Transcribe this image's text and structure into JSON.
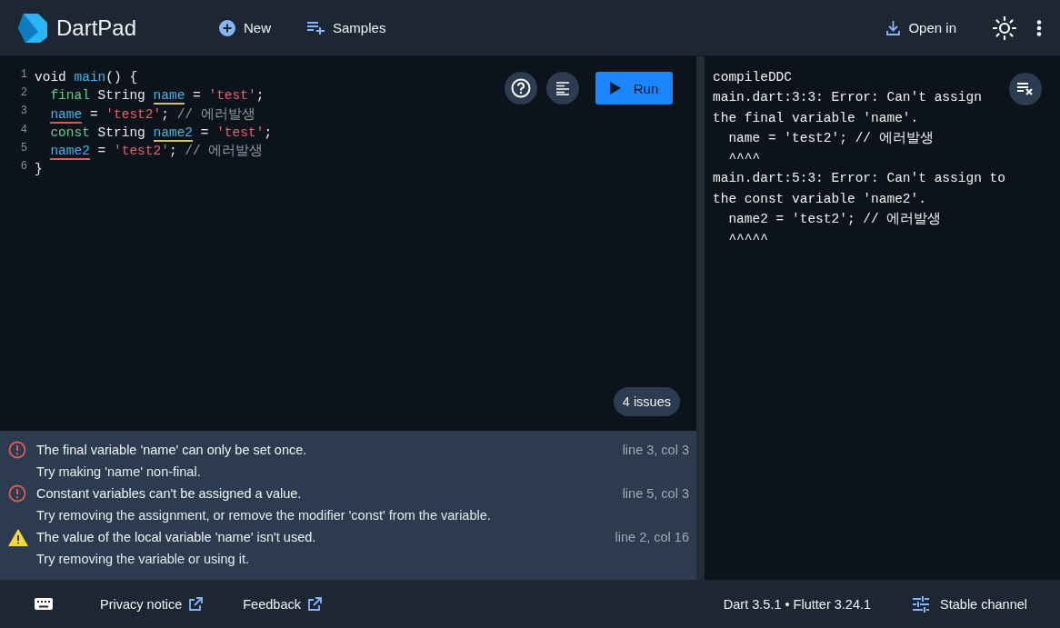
{
  "header": {
    "title": "DartPad",
    "actions": [
      {
        "kind": "new",
        "label": "New"
      },
      {
        "kind": "samples",
        "label": "Samples"
      }
    ],
    "open_in": "Open in"
  },
  "editor": {
    "lines": [
      {
        "number": "1",
        "indented": false,
        "tokens": [
          {
            "kind": "plain",
            "text": "void "
          },
          {
            "kind": "func",
            "text": "main"
          },
          {
            "kind": "plain",
            "text": "() {"
          }
        ]
      },
      {
        "number": "2",
        "indented": true,
        "tokens": [
          {
            "kind": "keyword",
            "text": "final"
          },
          {
            "kind": "plain",
            "text": " String "
          },
          {
            "kind": "ident",
            "text": "name",
            "has_warning": true
          },
          {
            "kind": "plain",
            "text": " = "
          },
          {
            "kind": "string",
            "text": "'test'"
          },
          {
            "kind": "plain",
            "text": ";"
          }
        ]
      },
      {
        "number": "3",
        "indented": true,
        "tokens": [
          {
            "kind": "ident",
            "text": "name",
            "has_error": true
          },
          {
            "kind": "plain",
            "text": " = "
          },
          {
            "kind": "string",
            "text": "'test2'"
          },
          {
            "kind": "plain",
            "text": "; "
          },
          {
            "kind": "comment",
            "text": "// 에러발생"
          }
        ]
      },
      {
        "number": "4",
        "indented": true,
        "tokens": [
          {
            "kind": "keyword",
            "text": "const"
          },
          {
            "kind": "plain",
            "text": " String "
          },
          {
            "kind": "ident",
            "text": "name2",
            "has_warning": true
          },
          {
            "kind": "plain",
            "text": " = "
          },
          {
            "kind": "string",
            "text": "'test'"
          },
          {
            "kind": "plain",
            "text": ";"
          }
        ]
      },
      {
        "number": "5",
        "indented": true,
        "tokens": [
          {
            "kind": "ident",
            "text": "name2",
            "has_error": true
          },
          {
            "kind": "plain",
            "text": " = "
          },
          {
            "kind": "string",
            "text": "'test2'"
          },
          {
            "kind": "plain",
            "text": "; "
          },
          {
            "kind": "comment",
            "text": "// 에러발생"
          }
        ]
      },
      {
        "number": "6",
        "indented": false,
        "tokens": [
          {
            "kind": "plain",
            "text": "}"
          }
        ]
      }
    ],
    "run_label": "Run",
    "issue_count": "4 issues"
  },
  "issues": [
    {
      "kind": "error",
      "message": "The final variable 'name' can only be set once.",
      "location": "line 3, col 3",
      "hint": "Try making 'name' non-final."
    },
    {
      "kind": "error",
      "message": "Constant variables can't be assigned a value.",
      "location": "line 5, col 3",
      "hint": "Try removing the assignment, or remove the modifier 'const' from the variable."
    },
    {
      "kind": "warning",
      "message": "The value of the local variable 'name' isn't used.",
      "location": "line 2, col 16",
      "hint": "Try removing the variable or using it."
    }
  ],
  "console": {
    "lines": [
      "compileDDC",
      "main.dart:3:3: Error: Can't assign",
      "the final variable 'name'.",
      "  name = 'test2'; // 에러발생",
      "  ^^^^",
      "main.dart:5:3: Error: Can't assign to",
      "the const variable 'name2'.",
      "  name2 = 'test2'; // 에러발생",
      "  ^^^^^"
    ]
  },
  "footer": {
    "links": [
      "Privacy notice",
      "Feedback"
    ],
    "version": "Dart 3.5.1 • Flutter 3.24.1",
    "channel": "Stable channel"
  }
}
